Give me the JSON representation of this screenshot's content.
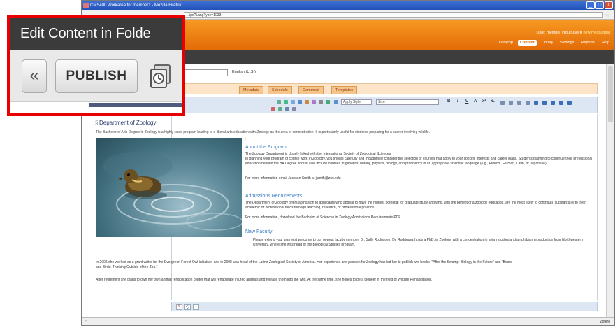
{
  "window": {
    "title": "CMS400 Workarea for member1 - Mozilla Firefox",
    "url": "...ipx?LangType=1033",
    "controls": [
      "_",
      "□",
      "X"
    ]
  },
  "header": {
    "user_prefix": "User: member (You have ",
    "user_bold": "0",
    "user_suffix": " new messages)",
    "nav": [
      "Desktop",
      "Content",
      "Library",
      "Settings",
      "Reports",
      "Help"
    ],
    "active_nav": "Content"
  },
  "editor": {
    "language": "English (U.S.)",
    "tabs": [
      "Metadata",
      "Schedule",
      "Comment",
      "Templates"
    ],
    "toolbar": {
      "style": "Apply Style",
      "size": "Size",
      "format_buttons": [
        "B",
        "I",
        "U",
        "A",
        "x²",
        "x₂"
      ]
    },
    "heading": "Department of Zoology",
    "intro": "The Bachelor of Arts Degree in Zoology is a highly rated program leading to a liberal arts education with Zoology as the area of concentration. It is particularly useful for students preparing for a career involving wildlife.",
    "sections": {
      "about_title": "About the Program",
      "about_p1": "The Zoology Department is closely linked with the International Society of Zoological Sciences.",
      "about_p2": "In planning your program of course work in Zoology, you should carefully and thoughtfully consider the selection of courses that apply to your specific interests and career plans. Students planning to continue their professional education beyond the BA Degree should also include courses in genetics, botany, physics, biology, and proficiency in an appropriate scientific language (e.g., French, German, Latin, or Japanese).",
      "about_p3": "For more information email Jackson Smith at jsmith@zoo.edu",
      "adm_title": "Admissions Requirements",
      "adm_p1": "The Department of Zoology offers admission to applicants who appear to have the highest potential for graduate study and who, with the benefit of a zoology education, are the most likely to contribute substantially to their academic or professional fields through teaching, research, or professional practice.",
      "adm_p2": "For more information, download the Bachelor of Sciences in Zoology Admissions Requirements PDF.",
      "faculty_title": "New Faculty",
      "faculty_p1": "Please extend your warmest welcome to our newest faculty member, Dr. Sally Rodriguez. Dr. Rodriguez holds a PhD. in Zoology with a concentration in avian studies and amphibian reproduction from Northwestern University, where she was head of the Biological Studies program.",
      "faculty_p2": "In 2006 she worked as a grant writer for the Evergreen Forest Owl initiative, and in 2008 was head of the Latino Zoological Society of America. Her experience and passion for Zoology has led her to publish two books, \"After the Swamp: Biology in the Future\" and \"Bears and Birds: Thinking Outside of the Zoo.\"",
      "faculty_p3": "After retirement she plans to own her own animal rehabilitation center that will rehabilitate injured animals and release them into the wild. At the same time, she hopes to be a pioneer in the field of Wildlife Rehabilitation."
    }
  },
  "status": {
    "zoom": "Zotero"
  },
  "callout": {
    "title": "Edit Content in Folde",
    "back_label": "«",
    "publish_label": "PUBLISH",
    "border_color": "#e80000"
  },
  "colors": {
    "header_orange": "#e36b08",
    "heading_blue": "#3b7fc4",
    "callout_red": "#e80000"
  }
}
